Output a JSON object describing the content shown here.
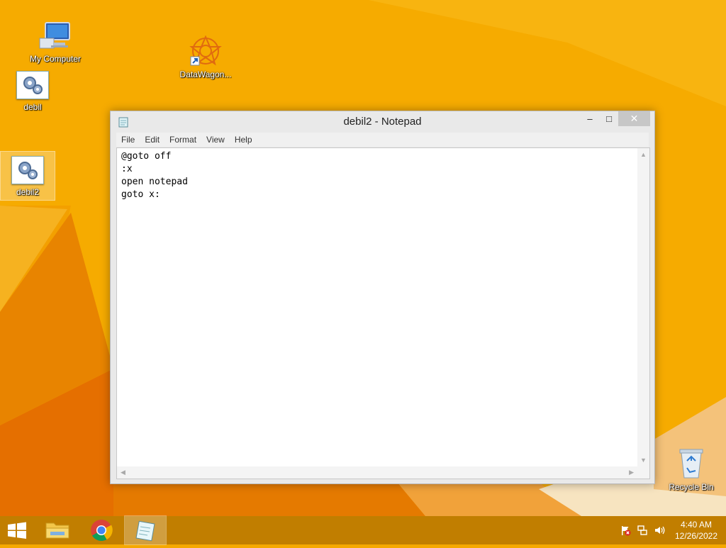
{
  "desktop": {
    "icons": [
      {
        "label": "My Computer",
        "icon": "computer-icon"
      },
      {
        "label": "DataWagon...",
        "icon": "datawagon-shortcut-icon"
      },
      {
        "label": "debil",
        "icon": "batch-file-icon"
      },
      {
        "label": "debil2",
        "icon": "batch-file-icon",
        "selected": true
      },
      {
        "label": "Recycle Bin",
        "icon": "recycle-bin-icon"
      }
    ]
  },
  "window": {
    "title": "debil2 - Notepad",
    "icon": "notepad-icon",
    "controls": {
      "minimize": "–",
      "maximize": "□",
      "close": "✕"
    },
    "menu": [
      "File",
      "Edit",
      "Format",
      "View",
      "Help"
    ],
    "content": "@goto off\n:x\nopen notepad\ngoto x:"
  },
  "taskbar": {
    "items": [
      {
        "name": "start-button",
        "icon": "windows-logo-icon"
      },
      {
        "name": "file-explorer",
        "icon": "folder-icon"
      },
      {
        "name": "chrome",
        "icon": "chrome-icon"
      },
      {
        "name": "notepad",
        "icon": "notepad-icon",
        "active": true
      }
    ],
    "tray": [
      "action-center-flag-icon",
      "network-icon",
      "volume-icon"
    ],
    "clock": {
      "time": "4:40 AM",
      "date": "12/26/2022"
    }
  },
  "colors": {
    "wallpaper": "#f5a800",
    "wallpaper_dark": "#e07000",
    "window_close": "#c7c7c7"
  }
}
